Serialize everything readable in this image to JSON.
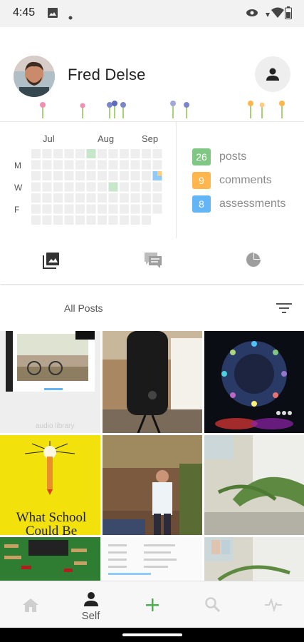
{
  "status_bar": {
    "time": "4:45",
    "icons": [
      "image-icon",
      "dot-icon",
      "eye-icon",
      "wifi-icon",
      "battery-icon"
    ]
  },
  "profile": {
    "name": "Fred Delse",
    "avatar_icon": "avatar-photo",
    "action_icon": "person-icon"
  },
  "calendar": {
    "months": [
      "Jul",
      "Aug",
      "Sep"
    ],
    "days": [
      "M",
      "W",
      "F"
    ],
    "cell_colors": {
      "empty": "#eeeeee",
      "post": "#c8e6c9",
      "comment": "#ffcc80",
      "assessment": "#90caf9"
    }
  },
  "counts": [
    {
      "value": "26",
      "label": "posts",
      "color": "#81c784"
    },
    {
      "value": "9",
      "label": "comments",
      "color": "#ffb74d"
    },
    {
      "value": "8",
      "label": "assessments",
      "color": "#64b5f6"
    }
  ],
  "tabs": [
    {
      "name": "tab-posts",
      "icon": "photo-library-icon",
      "active": true
    },
    {
      "name": "tab-comments",
      "icon": "comments-icon",
      "active": false
    },
    {
      "name": "tab-assessments",
      "icon": "pie-chart-icon",
      "active": false
    }
  ],
  "filter": {
    "label": "All Posts",
    "icon": "filter-icon"
  },
  "posts": [
    {
      "caption": "audio library"
    },
    {
      "caption": ""
    },
    {
      "caption": ""
    },
    {
      "caption": "What School Could Be"
    },
    {
      "caption": ""
    },
    {
      "caption": ""
    },
    {
      "caption": ""
    },
    {
      "caption": ""
    },
    {
      "caption": ""
    }
  ],
  "bottom_nav": [
    {
      "name": "nav-home",
      "icon": "home-icon",
      "label": ""
    },
    {
      "name": "nav-self",
      "icon": "person-icon",
      "label": "Self"
    },
    {
      "name": "nav-add",
      "icon": "plus-icon",
      "label": ""
    },
    {
      "name": "nav-search",
      "icon": "search-icon",
      "label": ""
    },
    {
      "name": "nav-activity",
      "icon": "activity-icon",
      "label": ""
    }
  ]
}
